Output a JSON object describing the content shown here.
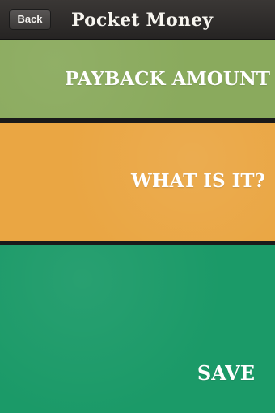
{
  "navbar": {
    "back_label": "Back",
    "title": "Pocket Money"
  },
  "form": {
    "payback_amount_label": "PAYBACK AMOUNT",
    "what_is_it_label": "WHAT IS IT?",
    "save_label": "SAVE"
  },
  "colors": {
    "navbar": "#2f2d2c",
    "payback_panel": "#8aaa5d",
    "what_panel": "#eaa643",
    "save_panel": "#1b9a68"
  }
}
